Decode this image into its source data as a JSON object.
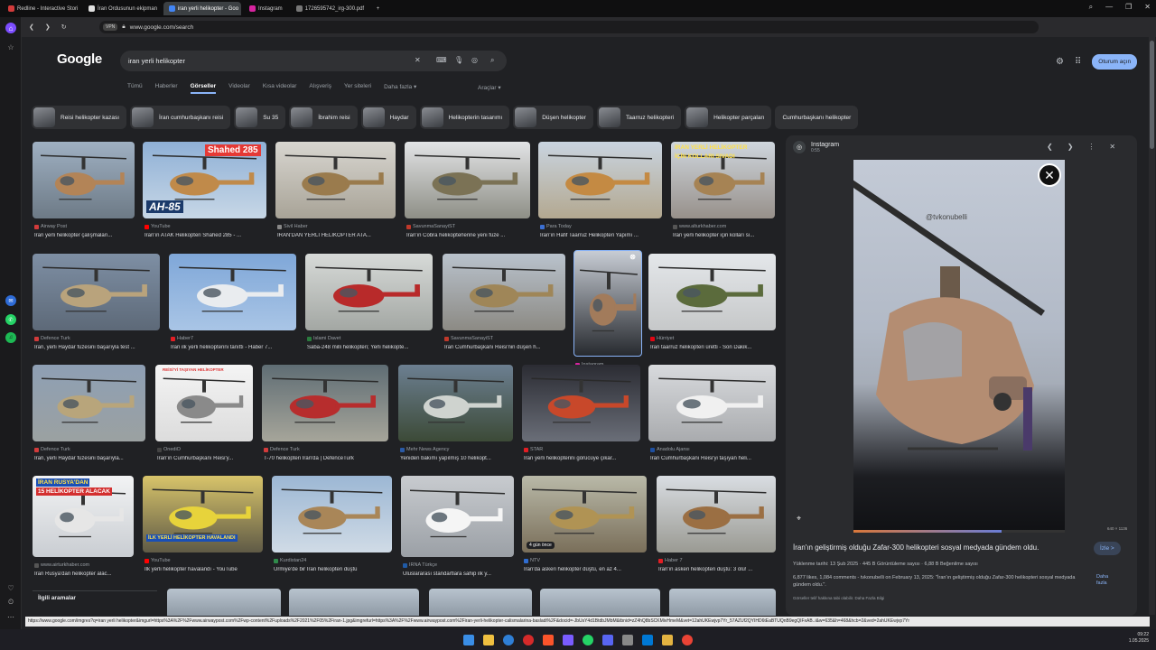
{
  "browser": {
    "tabs": [
      {
        "title": "Redline - Interactive Stori",
        "color": "#d23b3b",
        "active": false
      },
      {
        "title": "İran Ordusunun ekipman",
        "color": "#e0e0e0",
        "active": false
      },
      {
        "title": "iran yerli helikopter - Goo",
        "color": "#4285f4",
        "active": true
      },
      {
        "title": "Instagram",
        "color": "#d6249f",
        "active": false
      },
      {
        "title": "1726595742_irg-300.pdf",
        "color": "#777777",
        "active": false
      }
    ],
    "new_tab": "+",
    "url": "www.google.com/search",
    "vpn": "VPN",
    "status_url": "https://www.google.com/imgres?q=iran yerli helikopter&imgurl=https%3A%2F%2Fwww.airwaypost.com%2Fwp-content%2Fuploads%2F2021%2F05%2Firan-1.jpg&imgrefurl=https%3A%2F%2Fwww.airwaypost.com%2Firan-yerli-helikopter-calismalarina-basladi%2F&docid=-JbUsY4d1BtdbJMbM&tbnid=zZ4hQ8bSCKMivHmeM&vet=12ahUKEwjvp7Yr_57AZUf2QYIHD6tEaBTUQnB9egQIFxAB..i&w=635&h=468&hcb=2&ved=2ahUKEwjvp7Yr"
  },
  "google": {
    "logo": "Google",
    "query": "iran yerli helikopter",
    "nav_tabs": [
      "Tümü",
      "Haberler",
      "Görseller",
      "Videolar",
      "Kısa videolar",
      "Alışveriş",
      "Yer siteleri",
      "Daha fazla ▾"
    ],
    "active_tab": "Görseller",
    "tools": "Araçlar ▾",
    "sign_in": "Oturum açın",
    "chips": [
      {
        "label": "Reisi helikopter kazası",
        "img": true
      },
      {
        "label": "İran cumhurbaşkanı reisi",
        "img": true
      },
      {
        "label": "Su 35",
        "img": true
      },
      {
        "label": "İbrahim reisi",
        "img": true
      },
      {
        "label": "Haydar",
        "img": true
      },
      {
        "label": "Helikopterin tasarımı",
        "img": true
      },
      {
        "label": "Düşen helikopter",
        "img": true
      },
      {
        "label": "Taarruz helikopteri",
        "img": true
      },
      {
        "label": "Helikopter parçaları",
        "img": true
      },
      {
        "label": "Cumhurbaşkanı helikopter",
        "img": false
      }
    ],
    "related_searches": "İlgili aramalar"
  },
  "results": [
    {
      "source": "Airway Post",
      "caption": "İran yerli helikopter çalışmaları...",
      "color": "#d23b3b",
      "bg": "linear-gradient(180deg,#9fb0c2,#6d7a86)",
      "body": "#b38457"
    },
    {
      "source": "YouTube",
      "caption": "İran'ın ATAK Helikopteri Shahed 285 - ...",
      "color": "#ff0000",
      "bg": "linear-gradient(180deg,#8fb0d6,#c7d7e6)",
      "body": "#c08a4a",
      "text1": "Shahed 285",
      "text2": "AH-85"
    },
    {
      "source": "Sivil Haber",
      "caption": "İRAN'DAN YERLİ HELİKOPTER ATA...",
      "color": "#888888",
      "bg": "linear-gradient(180deg,#d8d6d0,#a8a397)",
      "body": "#9a7b4d"
    },
    {
      "source": "SavunmaSanayiST",
      "caption": "İran'ın Cobra helikopterlerine yeni füze ...",
      "color": "#c0392b",
      "bg": "linear-gradient(180deg,#e2e4e6,#8e8f86)",
      "body": "#7b7255"
    },
    {
      "source": "Para Today",
      "caption": "İran'ın Hafif Taarruz Helikopteri Yapımı ...",
      "color": "#3b6fd2",
      "bg": "linear-gradient(180deg,#c9d4e0,#b3a890)",
      "body": "#c48a43"
    },
    {
      "source": "www.alturkhaber.com",
      "caption": "İran yerli helikopter için kolları sı...",
      "color": "#555555",
      "bg": "linear-gradient(180deg,#cfd6dd,#97908a)",
      "body": "#a68354",
      "text1": "İRAN YERLİ HELİKOPTER",
      "text2": "İÇİN KOLLARI SIVADI"
    },
    {
      "source": "Defence Turk",
      "caption": "İran, yerli Haydar füzesini başarıyla test ...",
      "color": "#d23b3b",
      "bg": "linear-gradient(180deg,#7e8fa4,#5d6978)",
      "body": "#b9a37c"
    },
    {
      "source": "Haber7",
      "caption": "İran ilk yerli helikopterini tanıttı - Haber 7...",
      "color": "#e31e24",
      "bg": "linear-gradient(180deg,#7fa7d8,#a9c5e6)",
      "body": "#e9ecef"
    },
    {
      "source": "İslami Davet",
      "caption": "Saba-248 milli helikopteri; Yerli helikopte...",
      "color": "#2a7b3e",
      "bg": "linear-gradient(180deg,#d7dad8,#a3a7a3)",
      "body": "#b82a2a"
    },
    {
      "source": "SavunmaSanayiST",
      "caption": "İran Cumhurbaşkanı Reisi'nin düşen h...",
      "color": "#c0392b",
      "bg": "linear-gradient(180deg,#b9c2cc,#8c8a84)",
      "body": "#9f8658"
    },
    {
      "source": "Instagram",
      "caption": "İran'ın geliştirmiş o...",
      "color": "#d6249f",
      "bg": "linear-gradient(180deg,#c7ccd4,#272a2f)",
      "body": "#a27b5b"
    },
    {
      "source": "Hürriyet",
      "caption": "İran taarruz helikopteri üretti - Son Dakik...",
      "color": "#e30613",
      "bg": "linear-gradient(180deg,#e4e7ea,#c6c8c9)",
      "body": "#5b6b3c"
    },
    {
      "source": "Defence Turk",
      "caption": "İran, yerli Haydar füzesini başarıyla...",
      "color": "#d23b3b",
      "bg": "linear-gradient(180deg,#8e9fb4,#9ba1a1)",
      "body": "#b8a57b"
    },
    {
      "source": "OnediO",
      "caption": "İran'ın Cumhurbaşkanı Reisi'y...",
      "color": "#444444",
      "bg": "linear-gradient(180deg,#f4f4f4,#dcdcdc)",
      "body": "#8a8a8a",
      "text1": "REİSİ'Yİ TAŞIYAN HELİKOPTER"
    },
    {
      "source": "Defence Turk",
      "caption": "T-70 helikopteri İran'da | DefenceTurk",
      "color": "#d23b3b",
      "bg": "linear-gradient(180deg,#5f6d74,#a6a59a)",
      "body": "#b72d2d"
    },
    {
      "source": "Mehr News Agency",
      "caption": "Yeniden bakımı yapılmış 10 helikopt...",
      "color": "#2a5aa6",
      "bg": "linear-gradient(180deg,#6c7f91,#3c4a37)",
      "body": "#cfd3cf"
    },
    {
      "source": "STAR",
      "caption": "İran yerli helikopterini görücüye çıkar...",
      "color": "#e31e24",
      "bg": "linear-gradient(180deg,#2b2c33,#6a6e78)",
      "body": "#c8482a"
    },
    {
      "source": "Anadolu Ajansı",
      "caption": "İran Cumhurbaşkanı Reisi'yi taşıyan heli...",
      "color": "#1e4fa0",
      "bg": "linear-gradient(180deg,#d8dadd,#a9abae)",
      "body": "#f0f0f0"
    },
    {
      "source": "www.airturkhaber.com",
      "caption": "İran Rusya'dan helikopter alac...",
      "color": "#555555",
      "bg": "linear-gradient(180deg,#f2f3f4,#c9cdd2)",
      "body": "#e6e6e6",
      "text1": "İRAN RUSYA'DAN",
      "text2": "15 HELİKOPTER ALACAK"
    },
    {
      "source": "YouTube",
      "caption": "İlk yerli helikopter havalandı - YouTube",
      "color": "#ff0000",
      "bg": "linear-gradient(180deg,#d8c46a,#5f5a46)",
      "body": "#e7d33b",
      "text1": "İLK YERLİ HELİKOPTER HAVALANDI"
    },
    {
      "source": "Kurdistan24",
      "caption": "Urmiye'de bir İran helikopteri düştü",
      "color": "#2f8a4a",
      "bg": "linear-gradient(180deg,#9cb7d4,#d0dbe6)",
      "body": "#a98658"
    },
    {
      "source": "IRNA Türkçe",
      "caption": "Uluslararası standartlara sahip ilk y...",
      "color": "#1f5aa6",
      "bg": "linear-gradient(180deg,#c8cbcf,#9ba0a6)",
      "body": "#f5f5f5"
    },
    {
      "source": "NTV",
      "caption": "İran'da askeri helikopter düştü, en az 4...",
      "color": "#2f6dd1",
      "bg": "linear-gradient(180deg,#b9b9a8,#7a6f5a)",
      "body": "#b09354",
      "badge": "4 gün önce"
    },
    {
      "source": "Haber 7",
      "caption": "İran'ın askeri helikopteri düştü: 3 ölü! ...",
      "color": "#e31e24",
      "bg": "linear-gradient(180deg,#d9dde2,#9a9a93)",
      "body": "#9b6f43"
    }
  ],
  "panel": {
    "site": "Instagram",
    "site_sub": "0:55",
    "watermark": "@tvkonubelli",
    "resolution": "640 × 1136",
    "caption": "İran'ın geliştirmiş olduğu Zafar-300 helikopteri sosyal medyada gündem oldu.",
    "visit": "İzle >",
    "meta": "Yüklenme tarihi: 13 Şub 2025 · 445 B Görüntüleme sayısı · 6,88 B Beğenilme sayısı",
    "description": "6,877 likes, 1,084 comments - tvkonubelli on February 13, 2025: \"İran'ın geliştirmiş olduğu Zafar-300 helikopteri sosyal medyada gündem oldu.\".",
    "more": "Daha fazla",
    "footer": "Görseller telif hakkına tabi olabilir. Daha Fazla Bilgi"
  },
  "taskbar": {
    "time": "09:22",
    "date": "1.05.2025"
  }
}
